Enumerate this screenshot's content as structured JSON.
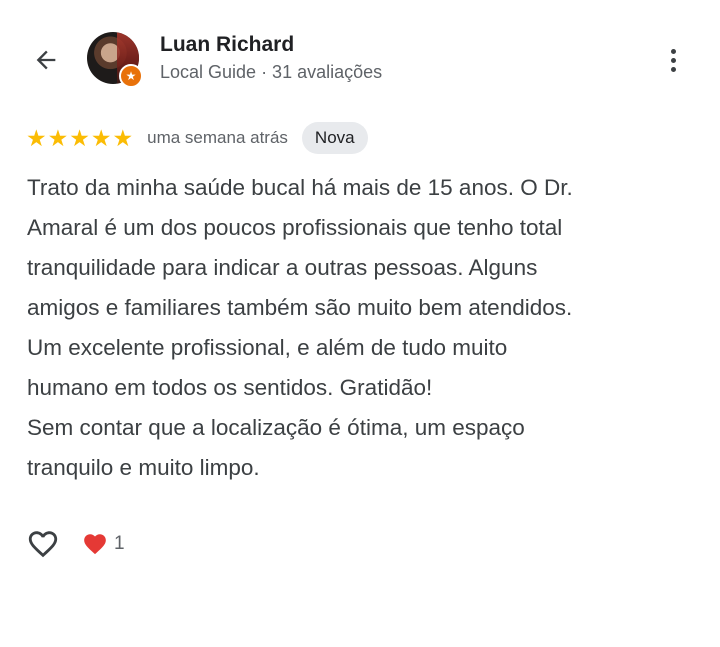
{
  "header": {
    "user_name": "Luan Richard",
    "user_meta": "Local Guide · 31 avaliações",
    "back_icon": "arrow-left-icon",
    "more_icon": "more-vert-icon"
  },
  "rating": {
    "stars": 5,
    "max_stars": 5,
    "time_ago": "uma semana atrás",
    "badge": "Nova",
    "star_color": "#fbbc04"
  },
  "review": {
    "lines": [
      "Trato da minha saúde bucal há mais de 15 anos. O Dr.",
      "Amaral é um dos poucos profissionais que tenho total",
      "tranquilidade para indicar a outras pessoas. Alguns",
      "amigos e familiares também são muito bem atendidos.",
      "Um excelente profissional, e além de tudo muito",
      "humano em todos os sentidos. Gratidão!",
      "Sem contar que a localização é ótima, um espaço",
      "tranquilo e muito limpo."
    ]
  },
  "actions": {
    "like_icon": "heart-outline-icon",
    "reaction_icon": "red-heart-icon",
    "reaction_count": "1",
    "reaction_color": "#e53935"
  }
}
